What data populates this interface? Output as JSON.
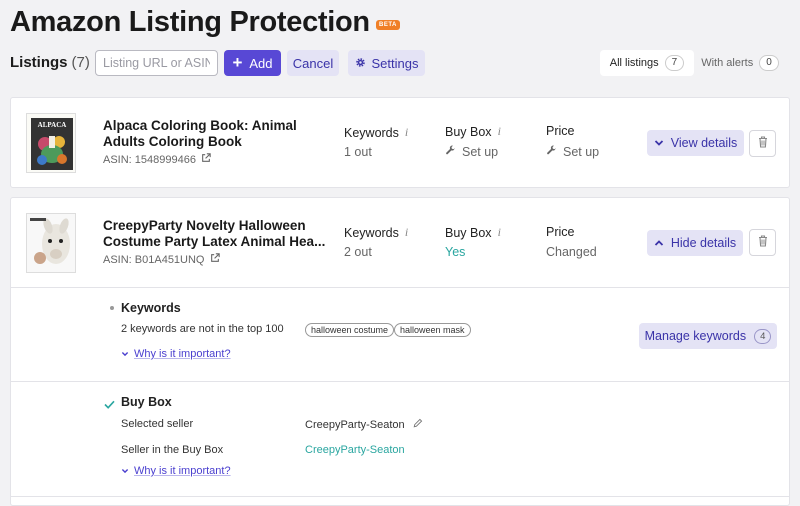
{
  "header": {
    "title": "Amazon Listing Protection",
    "badge": "BETA"
  },
  "toolbar": {
    "listings_label": "Listings",
    "listings_count": "(7)",
    "url_placeholder": "Listing URL or ASIN",
    "add_label": "Add",
    "cancel_label": "Cancel",
    "settings_label": "Settings"
  },
  "filters": {
    "all_label": "All listings",
    "all_count": "7",
    "alerts_label": "With alerts",
    "alerts_count": "0"
  },
  "listings": [
    {
      "title_line1": "Alpaca Coloring Book: Animal",
      "title_line2": "Adults Coloring Book",
      "asin": "ASIN: 1548999466",
      "keywords_label": "Keywords",
      "keywords_value": "1 out",
      "buybox_label": "Buy Box",
      "buybox_value": "Set up",
      "price_label": "Price",
      "price_value": "Set up",
      "details_button": "View details",
      "thumb_text": "ALPACA"
    },
    {
      "title_line1": "CreepyParty Novelty Halloween",
      "title_line2": "Costume Party Latex Animal Hea...",
      "asin": "ASIN: B01A451UNQ",
      "keywords_label": "Keywords",
      "keywords_value": "2 out",
      "buybox_label": "Buy Box",
      "buybox_value": "Yes",
      "price_label": "Price",
      "price_value": "Changed",
      "details_button": "Hide details"
    }
  ],
  "details": {
    "keywords": {
      "title": "Keywords",
      "message": "2 keywords are not in the top 100",
      "tags": [
        "halloween costume",
        "halloween mask"
      ],
      "why": "Why is it important?",
      "manage_label": "Manage keywords",
      "manage_count": "4"
    },
    "buybox": {
      "title": "Buy Box",
      "selected_seller_label": "Selected seller",
      "selected_seller_value": "CreepyParty-Seaton",
      "seller_in_box_label": "Seller in the Buy Box",
      "seller_in_box_value": "CreepyParty-Seaton",
      "why": "Why is it important?"
    }
  },
  "colors": {
    "primary": "#5848d5",
    "soft": "#e4e3f5",
    "teal": "#2aa6a0",
    "beta": "#f07f26"
  }
}
